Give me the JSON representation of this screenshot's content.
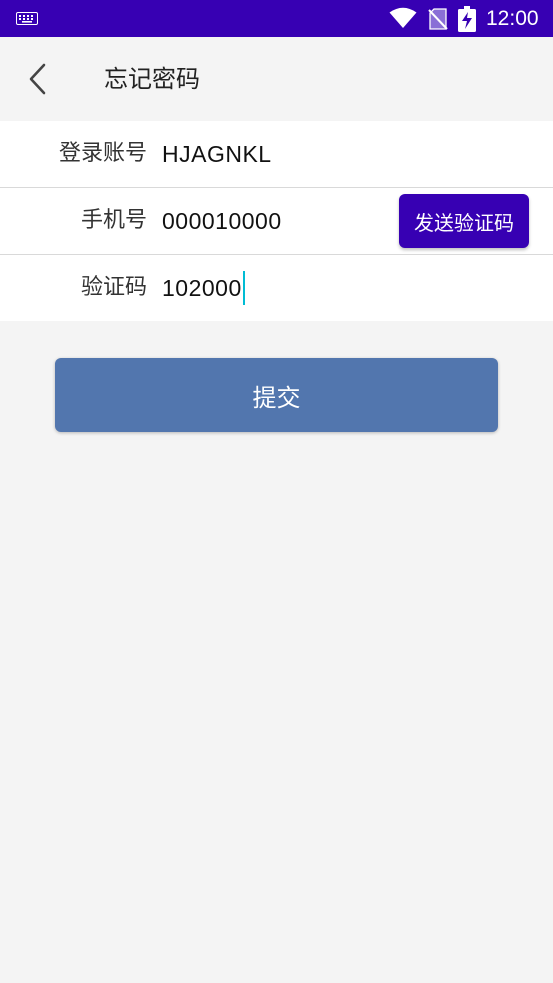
{
  "status_bar": {
    "time": "12:00",
    "icons": [
      "keyboard-icon",
      "wifi-icon",
      "no-sim-icon",
      "battery-charging-icon"
    ]
  },
  "header": {
    "title": "忘记密码",
    "back_icon": "chevron-left-icon"
  },
  "form": {
    "account": {
      "label": "登录账号",
      "value": "HJAGNKL"
    },
    "phone": {
      "label": "手机号",
      "value": "000010000",
      "send_code_label": "发送验证码"
    },
    "code": {
      "label": "验证码",
      "value": "102000"
    }
  },
  "submit_label": "提交",
  "colors": {
    "status_bar": "#3700b3",
    "accent": "#3700b3",
    "submit": "#5276ae",
    "caret": "#00bcd4",
    "background": "#f4f4f4"
  }
}
